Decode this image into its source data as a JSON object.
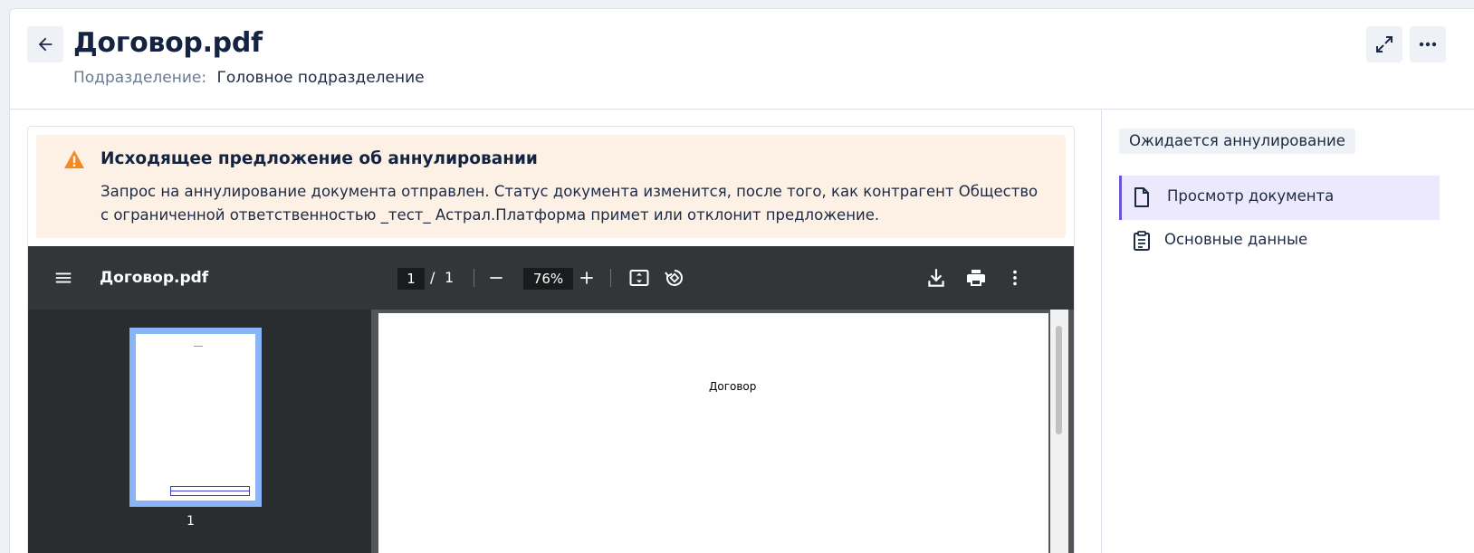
{
  "header": {
    "title": "Договор.pdf",
    "subdivision_label": "Подразделение:",
    "subdivision_value": "Головное подразделение"
  },
  "alert": {
    "title": "Исходящее предложение об аннулировании",
    "text": "Запрос на аннулирование документа отправлен. Статус документа изменится, после того, как контрагент Общество с ограниченной ответственностью _тест_ Астрал.Платформа примет или отклонит предложение.",
    "color": "#fdf1e6",
    "icon": "warning-icon"
  },
  "viewer": {
    "file_name": "Договор.pdf",
    "current_page": "1",
    "page_separator": "/",
    "total_pages": "1",
    "zoom": "76%",
    "thumbnail_label": "1",
    "page_heading": "Договор"
  },
  "sidebar": {
    "status": "Ожидается аннулирование",
    "items": [
      {
        "label": "Просмотр документа",
        "icon": "document-icon",
        "active": true
      },
      {
        "label": "Основные данные",
        "icon": "clipboard-icon",
        "active": false
      }
    ],
    "accent_color": "#6a55d9"
  }
}
